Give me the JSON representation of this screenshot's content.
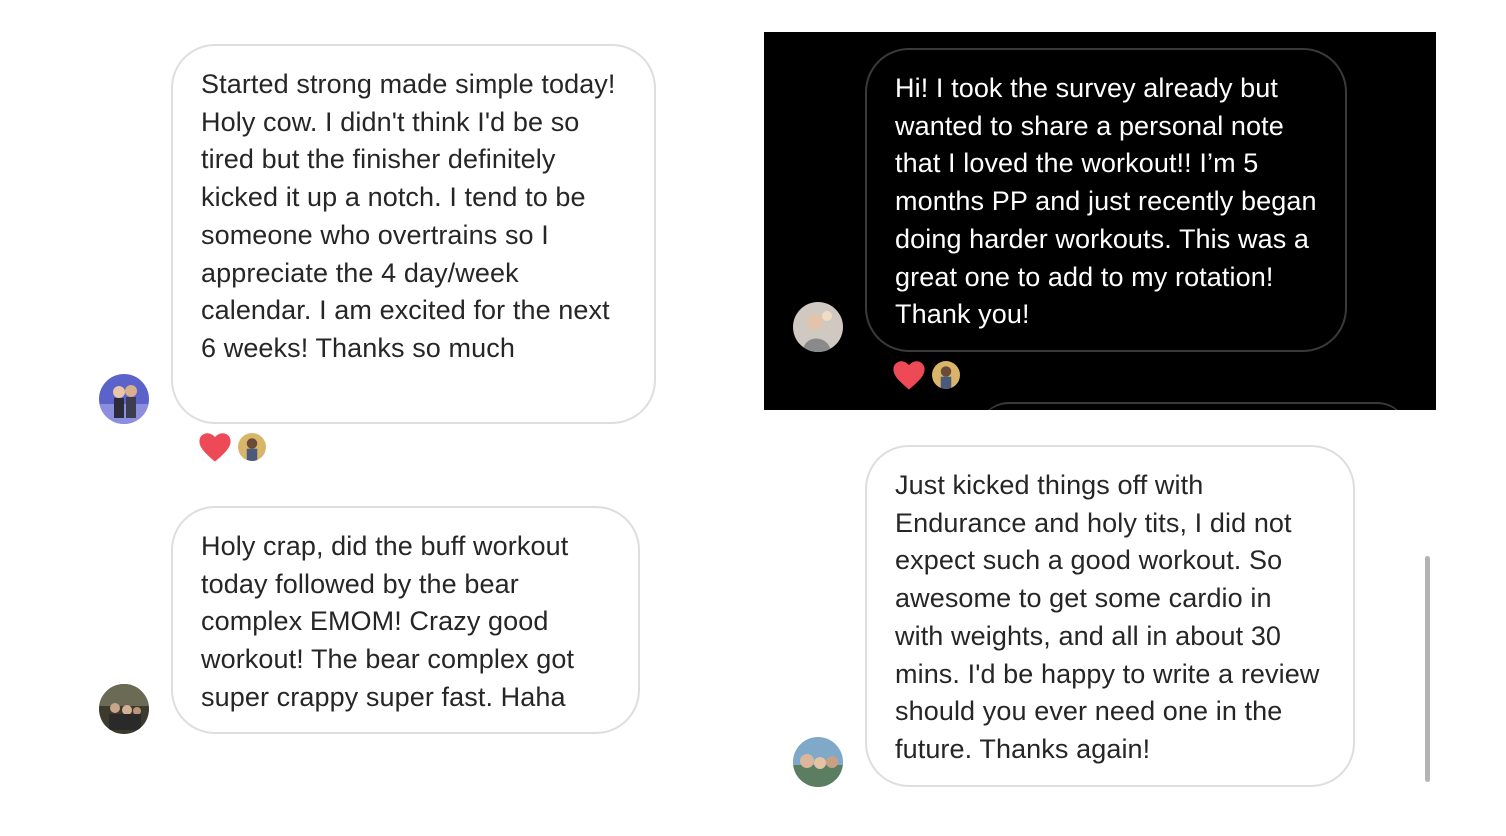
{
  "messages": [
    {
      "text": "Started strong made simple today! Holy cow. I didn't think I'd be so tired but the finisher definitely kicked it up a notch. I tend to be someone who overtrains so I appreciate the 4 day/week calendar. I am excited for the next 6 weeks! Thanks so much",
      "theme": "light",
      "reactions": [
        "heart-icon"
      ]
    },
    {
      "text": "Holy crap, did the buff workout today followed by the bear complex EMOM! Crazy good workout! The bear complex got super crappy super fast. Haha",
      "theme": "light",
      "reactions": []
    },
    {
      "text": "Hi! I took the survey already but wanted to share a personal note that I loved the workout!! I’m 5 months PP and just recently began doing harder workouts. This was a great one to add to my rotation! Thank you!",
      "theme": "dark",
      "reactions": [
        "heart-icon"
      ]
    },
    {
      "text": "Just kicked things off with Endurance and holy tits, I did not expect such a good workout. So awesome to get some cardio in with weights, and all in about 30 mins. I'd be happy to write a review should you ever need one in the future. Thanks again!",
      "theme": "light",
      "reactions": []
    }
  ],
  "colors": {
    "heart": "#ed4956",
    "bubble_border": "#dedede",
    "text": "#262626",
    "dark_background": "#000000"
  }
}
